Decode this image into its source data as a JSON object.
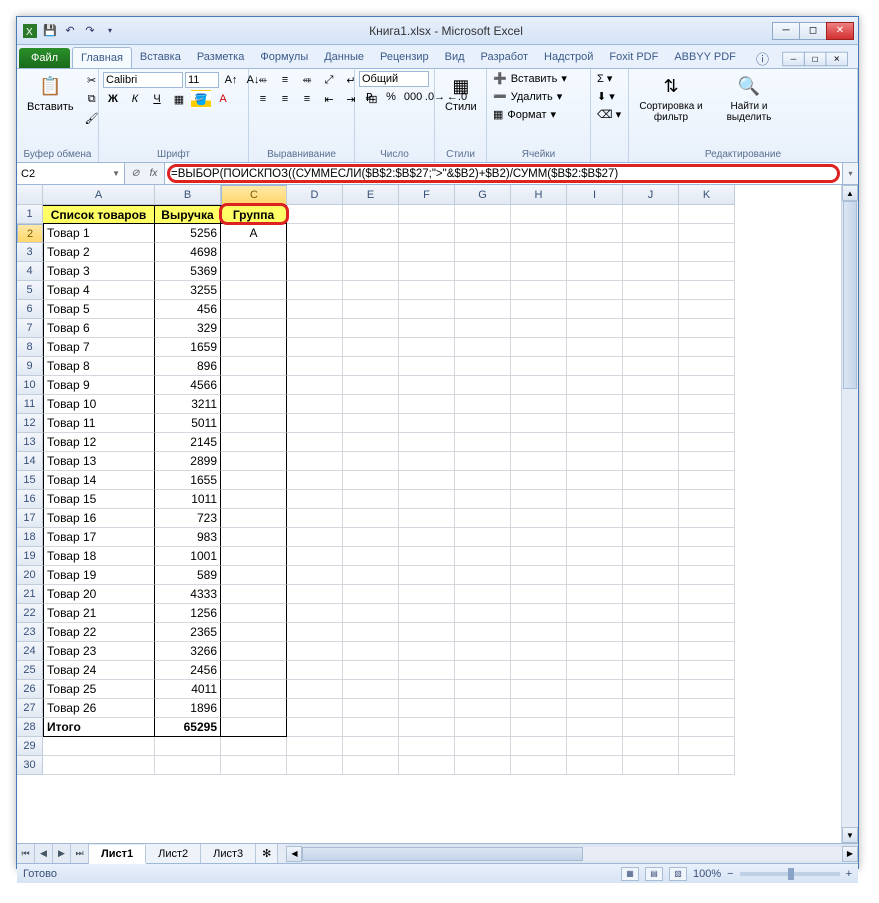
{
  "title": "Книга1.xlsx - Microsoft Excel",
  "qat": {
    "excel_icon": "X",
    "save": "💾",
    "undo": "↶",
    "redo": "↷"
  },
  "tabs": {
    "file": "Файл",
    "items": [
      "Главная",
      "Вставка",
      "Разметка",
      "Формулы",
      "Данные",
      "Рецензир",
      "Вид",
      "Разработ",
      "Надстрой",
      "Foxit PDF",
      "ABBYY PDF"
    ],
    "active": "Главная"
  },
  "ribbon": {
    "clipboard": {
      "paste": "Вставить",
      "label": "Буфер обмена"
    },
    "font": {
      "name": "Calibri",
      "size": "11",
      "label": "Шрифт"
    },
    "align": {
      "label": "Выравнивание"
    },
    "number": {
      "format": "Общий",
      "label": "Число"
    },
    "styles": {
      "label": "Стили",
      "btn": "Стили"
    },
    "cells": {
      "insert": "Вставить",
      "delete": "Удалить",
      "format": "Формат",
      "label": "Ячейки"
    },
    "editing": {
      "sort": "Сортировка и фильтр",
      "find": "Найти и выделить",
      "label": "Редактирование"
    }
  },
  "namebox": "C2",
  "formula": "=ВЫБОР(ПОИСКПОЗ((СУММЕСЛИ($B$2:$B$27;\">\"&$B2)+$B2)/СУММ($B$2:$B$27)",
  "columns": [
    "A",
    "B",
    "C",
    "D",
    "E",
    "F",
    "G",
    "H",
    "I",
    "J",
    "K"
  ],
  "headers": {
    "a": "Список товаров",
    "b": "Выручка",
    "c": "Группа"
  },
  "rows": [
    {
      "n": 2,
      "a": "Товар 1",
      "b": "5256",
      "c": "A"
    },
    {
      "n": 3,
      "a": "Товар 2",
      "b": "4698",
      "c": ""
    },
    {
      "n": 4,
      "a": "Товар 3",
      "b": "5369",
      "c": ""
    },
    {
      "n": 5,
      "a": "Товар 4",
      "b": "3255",
      "c": ""
    },
    {
      "n": 6,
      "a": "Товар 5",
      "b": "456",
      "c": ""
    },
    {
      "n": 7,
      "a": "Товар 6",
      "b": "329",
      "c": ""
    },
    {
      "n": 8,
      "a": "Товар 7",
      "b": "1659",
      "c": ""
    },
    {
      "n": 9,
      "a": "Товар 8",
      "b": "896",
      "c": ""
    },
    {
      "n": 10,
      "a": "Товар 9",
      "b": "4566",
      "c": ""
    },
    {
      "n": 11,
      "a": "Товар 10",
      "b": "3211",
      "c": ""
    },
    {
      "n": 12,
      "a": "Товар 11",
      "b": "5011",
      "c": ""
    },
    {
      "n": 13,
      "a": "Товар 12",
      "b": "2145",
      "c": ""
    },
    {
      "n": 14,
      "a": "Товар 13",
      "b": "2899",
      "c": ""
    },
    {
      "n": 15,
      "a": "Товар 14",
      "b": "1655",
      "c": ""
    },
    {
      "n": 16,
      "a": "Товар 15",
      "b": "1011",
      "c": ""
    },
    {
      "n": 17,
      "a": "Товар 16",
      "b": "723",
      "c": ""
    },
    {
      "n": 18,
      "a": "Товар 17",
      "b": "983",
      "c": ""
    },
    {
      "n": 19,
      "a": "Товар 18",
      "b": "1001",
      "c": ""
    },
    {
      "n": 20,
      "a": "Товар 19",
      "b": "589",
      "c": ""
    },
    {
      "n": 21,
      "a": "Товар 20",
      "b": "4333",
      "c": ""
    },
    {
      "n": 22,
      "a": "Товар 21",
      "b": "1256",
      "c": ""
    },
    {
      "n": 23,
      "a": "Товар 22",
      "b": "2365",
      "c": ""
    },
    {
      "n": 24,
      "a": "Товар 23",
      "b": "3266",
      "c": ""
    },
    {
      "n": 25,
      "a": "Товар 24",
      "b": "2456",
      "c": ""
    },
    {
      "n": 26,
      "a": "Товар 25",
      "b": "4011",
      "c": ""
    },
    {
      "n": 27,
      "a": "Товар 26",
      "b": "1896",
      "c": ""
    }
  ],
  "total_row": {
    "n": 28,
    "a": "Итого",
    "b": "65295",
    "c": ""
  },
  "extra_rows": [
    29,
    30
  ],
  "sheets": [
    "Лист1",
    "Лист2",
    "Лист3"
  ],
  "active_sheet": "Лист1",
  "status": "Готово",
  "zoom": "100%"
}
